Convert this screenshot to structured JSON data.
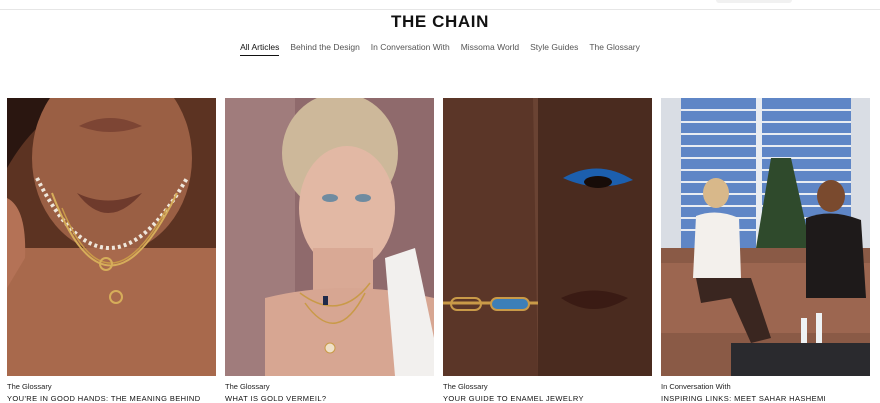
{
  "header": {
    "title": "THE CHAIN"
  },
  "tabs": [
    {
      "label": "All Articles"
    },
    {
      "label": "Behind the Design"
    },
    {
      "label": "In Conversation With"
    },
    {
      "label": "Missoma World"
    },
    {
      "label": "Style Guides"
    },
    {
      "label": "The Glossary"
    }
  ],
  "articles": [
    {
      "category": "The Glossary",
      "title": "YOU'RE IN GOOD HANDS: THE MEANING BEHIND"
    },
    {
      "category": "The Glossary",
      "title": "WHAT IS GOLD VERMEIL?"
    },
    {
      "category": "The Glossary",
      "title": "YOUR GUIDE TO ENAMEL JEWELRY"
    },
    {
      "category": "In Conversation With",
      "title": "INSPIRING LINKS: MEET SAHAR HASHEMI"
    }
  ],
  "colors": {
    "accent": "#111111",
    "muted": "#555555",
    "divider": "#e6e6e6"
  }
}
